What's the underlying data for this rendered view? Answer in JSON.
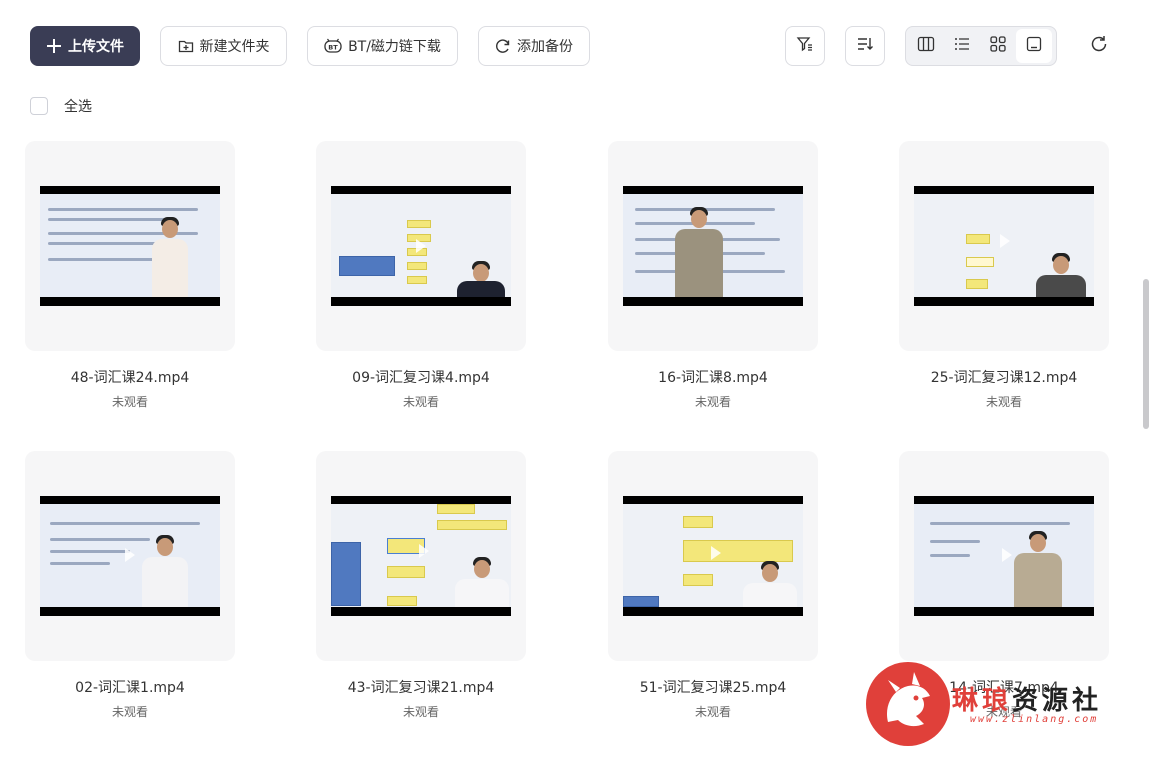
{
  "toolbar": {
    "upload_label": "上传文件",
    "new_folder_label": "新建文件夹",
    "bt_label": "BT/磁力链下载",
    "backup_label": "添加备份"
  },
  "select_all_label": "全选",
  "files": [
    {
      "name": "48-词汇课24.mp4",
      "status": "未观看"
    },
    {
      "name": "09-词汇复习课4.mp4",
      "status": "未观看"
    },
    {
      "name": "16-词汇课8.mp4",
      "status": "未观看"
    },
    {
      "name": "25-词汇复习课12.mp4",
      "status": "未观看"
    },
    {
      "name": "02-词汇课1.mp4",
      "status": "未观看"
    },
    {
      "name": "43-词汇复习课21.mp4",
      "status": "未观看"
    },
    {
      "name": "51-词汇复习课25.mp4",
      "status": "未观看"
    },
    {
      "name": "14-词汇课7.mp4",
      "status": "未观看"
    }
  ],
  "watermark": {
    "brand_red": "琳琅",
    "brand_dark": "资源社",
    "url": "www.zlinlang.com"
  },
  "colors": {
    "primary": "#3a3d55",
    "watermark_red": "#e0403a"
  },
  "icons": {
    "upload": "plus-icon",
    "new_folder": "folder-plus-icon",
    "bt": "bt-icon",
    "backup": "sync-icon",
    "filter": "filter-icon",
    "sort": "sort-icon",
    "view_column": "column-view-icon",
    "view_list": "list-view-icon",
    "view_grid": "grid-view-icon",
    "view_preview": "preview-view-icon",
    "refresh": "refresh-icon"
  }
}
